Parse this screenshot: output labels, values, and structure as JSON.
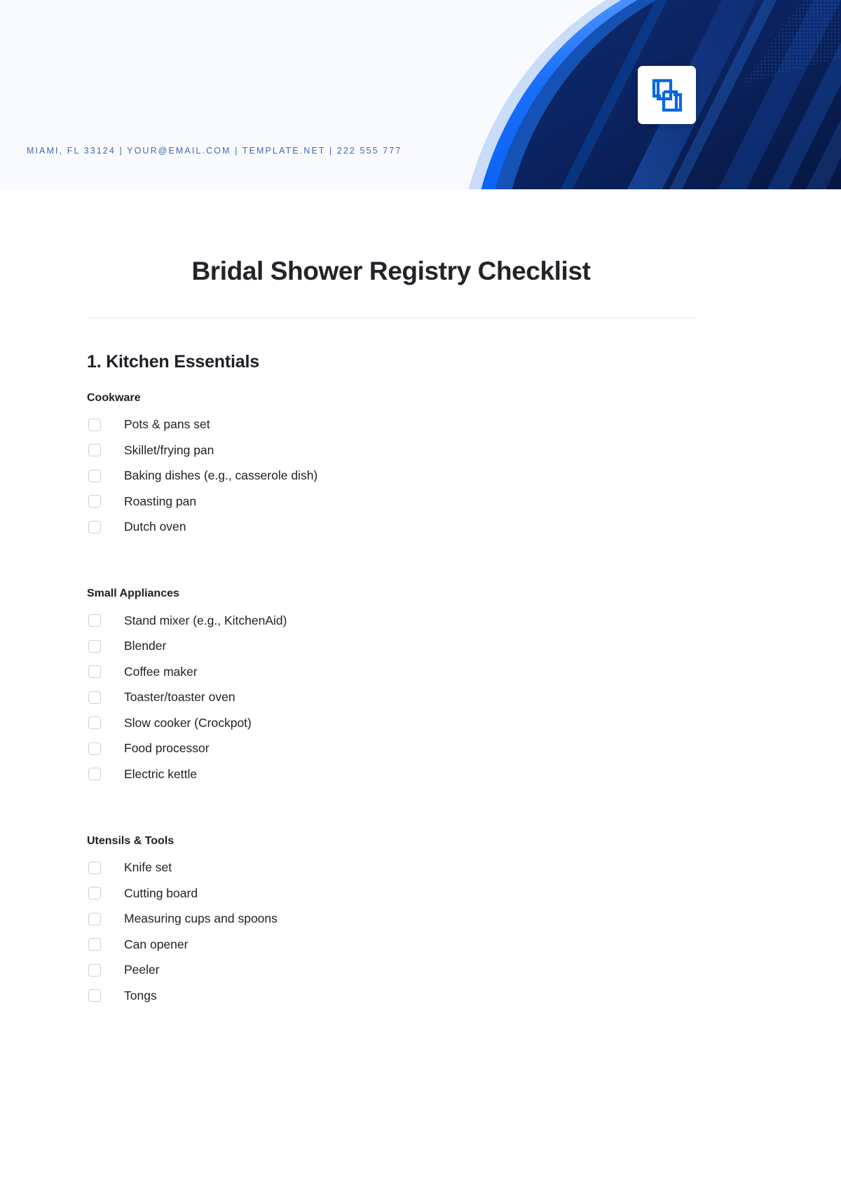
{
  "header": {
    "contact": "MIAMI, FL 33124 | YOUR@EMAIL.COM | TEMPLATE.NET | 222 555 777",
    "logo_icon": "overlapping-brackets-logo-icon",
    "accent_color": "#0b5cd6",
    "deep_blue": "#0b1f5c",
    "background_color": "#f9fafd",
    "contact_color": "#3c6bb5"
  },
  "document": {
    "title": "Bridal Shower Registry Checklist",
    "section_number_title": "1. Kitchen Essentials",
    "groups": [
      {
        "title": "Cookware",
        "items": [
          "Pots & pans set",
          "Skillet/frying pan",
          "Baking dishes (e.g., casserole dish)",
          "Roasting pan",
          "Dutch oven"
        ]
      },
      {
        "title": "Small Appliances",
        "items": [
          "Stand mixer (e.g., KitchenAid)",
          "Blender",
          "Coffee maker",
          "Toaster/toaster oven",
          "Slow cooker (Crockpot)",
          "Food processor",
          "Electric kettle"
        ]
      },
      {
        "title": "Utensils & Tools",
        "items": [
          "Knife set",
          "Cutting board",
          "Measuring cups and spoons",
          "Can opener",
          "Peeler",
          "Tongs"
        ]
      }
    ]
  }
}
